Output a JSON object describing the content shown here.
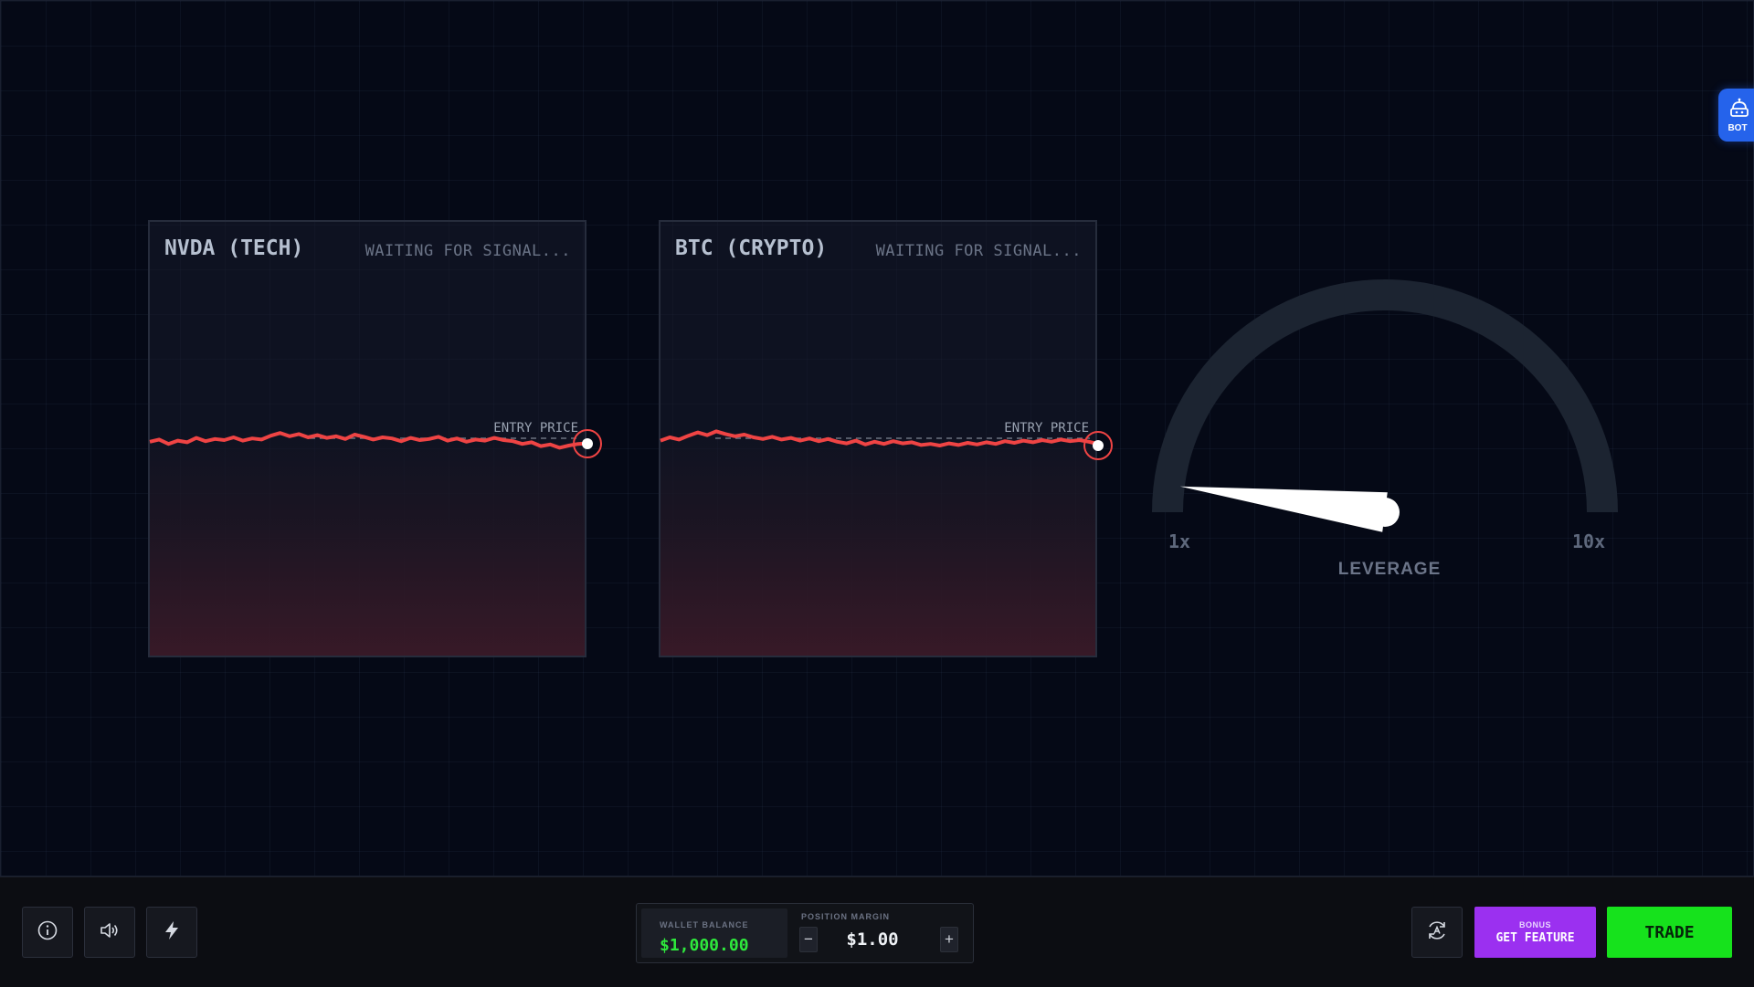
{
  "cards": [
    {
      "ticker": "NVDA (TECH)",
      "status": "WAITING FOR SIGNAL...",
      "entry_label": "ENTRY PRICE",
      "line_color": "#ef4444",
      "series": [
        0.2,
        0.6,
        -0.2,
        0.4,
        0.1,
        0.9,
        0.3,
        0.7,
        0.5,
        1.0,
        0.4,
        0.8,
        0.6,
        1.3,
        1.8,
        1.2,
        1.6,
        1.0,
        1.4,
        0.9,
        1.2,
        0.7,
        1.5,
        1.1,
        0.6,
        1.0,
        0.8,
        0.3,
        0.9,
        0.5,
        0.7,
        1.1,
        0.4,
        0.8,
        0.2,
        0.6,
        0.4,
        0.9,
        0.5,
        0.3,
        -0.2,
        0.1,
        -0.6,
        -0.3,
        -0.9,
        -0.5,
        -0.2,
        -0.1
      ]
    },
    {
      "ticker": "BTC (CRYPTO)",
      "status": "WAITING FOR SIGNAL...",
      "entry_label": "ENTRY PRICE",
      "line_color": "#ef4444",
      "series": [
        0.4,
        1.0,
        0.6,
        1.3,
        1.9,
        1.4,
        2.1,
        1.6,
        1.2,
        1.5,
        1.0,
        0.7,
        1.1,
        0.6,
        0.9,
        0.4,
        0.8,
        0.3,
        0.7,
        0.2,
        -0.1,
        0.4,
        -0.3,
        0.2,
        -0.2,
        0.3,
        -0.1,
        0.1,
        -0.4,
        -0.2,
        -0.5,
        -0.1,
        -0.4,
        0.0,
        -0.3,
        0.1,
        -0.2,
        0.3,
        0.0,
        0.4,
        0.1,
        0.5,
        0.2,
        0.6,
        0.3,
        0.5,
        0.2,
        -0.2
      ]
    }
  ],
  "gauge": {
    "min_label": "1x",
    "max_label": "10x",
    "label": "LEVERAGE",
    "value_fraction": 0.04,
    "track_color": "#1c2431",
    "needle_color": "#ffffff"
  },
  "bot": {
    "label": "BOT"
  },
  "wallet": {
    "balance_label": "WALLET BALANCE",
    "balance_value": "$1,000.00",
    "margin_label": "POSITION MARGIN",
    "margin_value": "$1.00",
    "minus": "−",
    "plus": "+"
  },
  "feature": {
    "top": "BONUS",
    "main": "GET FEATURE"
  },
  "trade": {
    "label": "TRADE"
  },
  "icons": [
    "info-icon",
    "volume-icon",
    "bolt-icon",
    "auto-icon",
    "bot-icon"
  ]
}
